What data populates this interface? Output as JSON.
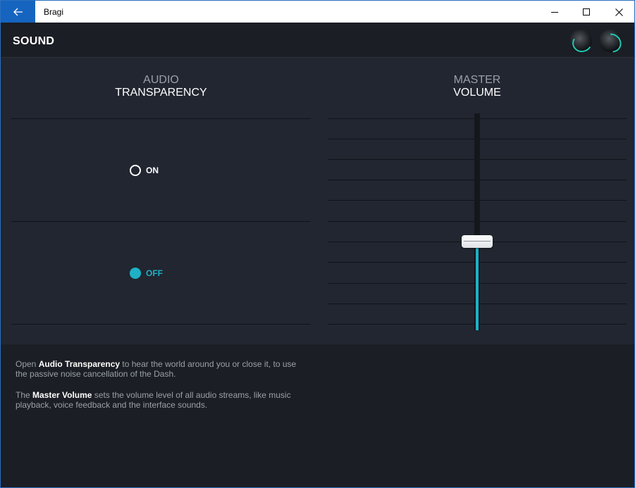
{
  "window": {
    "title": "Bragi",
    "back_icon": "arrow-left-icon",
    "minimize_icon": "minimize-icon",
    "maximize_icon": "maximize-icon",
    "close_icon": "close-icon"
  },
  "header": {
    "title": "SOUND",
    "devices": [
      "earbud-left",
      "earbud-right"
    ]
  },
  "audio_transparency": {
    "heading_line1": "AUDIO",
    "heading_line2": "TRANSPARENCY",
    "options": [
      {
        "label": "ON",
        "selected": false
      },
      {
        "label": "OFF",
        "selected": true
      }
    ]
  },
  "master_volume": {
    "heading_line1": "MASTER",
    "heading_line2": "VOLUME",
    "level": 0.41
  },
  "description": {
    "para1": {
      "before": "Open ",
      "bold": "Audio Transparency",
      "after": " to hear the world around you or close it, to use the passive noise cancellation of the Dash."
    },
    "para2": {
      "before": "The ",
      "bold": "Master Volume",
      "after": " sets the volume level of all audio streams, like music playback, voice feedback and the interface sounds."
    }
  },
  "colors": {
    "accent": "#1eb1c6",
    "background": "#1b1e24",
    "panel": "#212630",
    "titlebar_accent": "#1565c0"
  }
}
